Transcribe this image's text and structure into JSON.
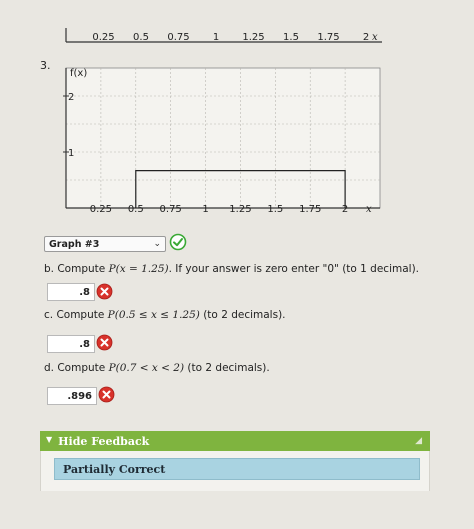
{
  "top_axis": {
    "ticks": [
      "0.25",
      "0.5",
      "0.75",
      "1",
      "1.25",
      "1.5",
      "1.75",
      "2"
    ],
    "x_label": "x"
  },
  "question": {
    "number": "3.",
    "graph": {
      "y_label": "f(x)",
      "y_ticks": [
        "2",
        "1"
      ],
      "x_ticks": [
        "0.25",
        "0.5",
        "0.75",
        "1",
        "1.25",
        "1.5",
        "1.75",
        "2"
      ],
      "x_label": "x",
      "density": {
        "x_start": 0.5,
        "x_end": 2,
        "height": 0.667
      },
      "x_range": [
        0,
        2.25
      ],
      "y_range": [
        0,
        2.5
      ]
    },
    "select": {
      "selected": "Graph #3",
      "status": "correct"
    },
    "parts": [
      {
        "prefix": "b. Compute ",
        "expr": "P(x = 1.25)",
        "suffix": ". If your answer is zero enter \"0\" (to 1 decimal).",
        "answer": ".8",
        "status": "incorrect"
      },
      {
        "prefix": "c. Compute ",
        "expr": "P(0.5 ≤ x ≤ 1.25)",
        "suffix": " (to 2 decimals).",
        "answer": ".8",
        "status": "incorrect"
      },
      {
        "prefix": "d. Compute ",
        "expr": "P(0.7 < x < 2)",
        "suffix": " (to 2 decimals).",
        "answer": ".896",
        "status": "incorrect"
      }
    ]
  },
  "feedback": {
    "toggle_label": "Hide Feedback",
    "status_text": "Partially Correct"
  },
  "colors": {
    "feedback_bar": "#7fb43f",
    "feedback_status": "#a9d3e1",
    "correct": "#3aa935",
    "incorrect": "#d8322b"
  }
}
